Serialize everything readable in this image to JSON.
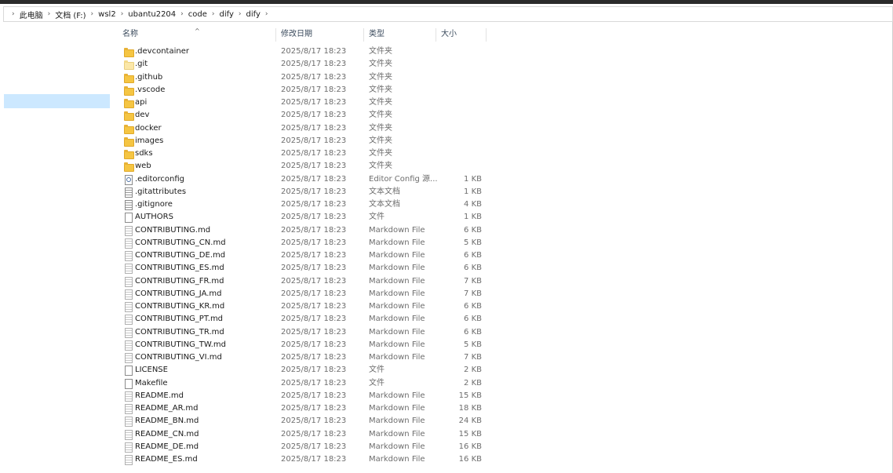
{
  "breadcrumb": [
    "此电脑",
    "文档 (F:)",
    "wsl2",
    "ubantu2204",
    "code",
    "dify",
    "dify"
  ],
  "columns": {
    "name": "名称",
    "date": "修改日期",
    "type": "类型",
    "size": "大小"
  },
  "files": [
    {
      "name": ".devcontainer",
      "date": "2025/8/17 18:23",
      "type": "文件夹",
      "size": "",
      "icon": "folder-icon"
    },
    {
      "name": ".git",
      "date": "2025/8/17 18:23",
      "type": "文件夹",
      "size": "",
      "icon": "folder-light-icon"
    },
    {
      "name": ".github",
      "date": "2025/8/17 18:23",
      "type": "文件夹",
      "size": "",
      "icon": "folder-icon"
    },
    {
      "name": ".vscode",
      "date": "2025/8/17 18:23",
      "type": "文件夹",
      "size": "",
      "icon": "folder-icon"
    },
    {
      "name": "api",
      "date": "2025/8/17 18:23",
      "type": "文件夹",
      "size": "",
      "icon": "folder-icon"
    },
    {
      "name": "dev",
      "date": "2025/8/17 18:23",
      "type": "文件夹",
      "size": "",
      "icon": "folder-icon"
    },
    {
      "name": "docker",
      "date": "2025/8/17 18:23",
      "type": "文件夹",
      "size": "",
      "icon": "folder-icon"
    },
    {
      "name": "images",
      "date": "2025/8/17 18:23",
      "type": "文件夹",
      "size": "",
      "icon": "folder-icon"
    },
    {
      "name": "sdks",
      "date": "2025/8/17 18:23",
      "type": "文件夹",
      "size": "",
      "icon": "folder-icon"
    },
    {
      "name": "web",
      "date": "2025/8/17 18:23",
      "type": "文件夹",
      "size": "",
      "icon": "folder-icon"
    },
    {
      "name": ".editorconfig",
      "date": "2025/8/17 18:23",
      "type": "Editor Config 源...",
      "size": "1 KB",
      "icon": "config-file-icon"
    },
    {
      "name": ".gitattributes",
      "date": "2025/8/17 18:23",
      "type": "文本文档",
      "size": "1 KB",
      "icon": "text-file-icon"
    },
    {
      "name": ".gitignore",
      "date": "2025/8/17 18:23",
      "type": "文本文档",
      "size": "4 KB",
      "icon": "text-file-icon"
    },
    {
      "name": "AUTHORS",
      "date": "2025/8/17 18:23",
      "type": "文件",
      "size": "1 KB",
      "icon": "file-icon"
    },
    {
      "name": "CONTRIBUTING.md",
      "date": "2025/8/17 18:23",
      "type": "Markdown File",
      "size": "6 KB",
      "icon": "markdown-file-icon"
    },
    {
      "name": "CONTRIBUTING_CN.md",
      "date": "2025/8/17 18:23",
      "type": "Markdown File",
      "size": "5 KB",
      "icon": "markdown-file-icon"
    },
    {
      "name": "CONTRIBUTING_DE.md",
      "date": "2025/8/17 18:23",
      "type": "Markdown File",
      "size": "6 KB",
      "icon": "markdown-file-icon"
    },
    {
      "name": "CONTRIBUTING_ES.md",
      "date": "2025/8/17 18:23",
      "type": "Markdown File",
      "size": "6 KB",
      "icon": "markdown-file-icon"
    },
    {
      "name": "CONTRIBUTING_FR.md",
      "date": "2025/8/17 18:23",
      "type": "Markdown File",
      "size": "7 KB",
      "icon": "markdown-file-icon"
    },
    {
      "name": "CONTRIBUTING_JA.md",
      "date": "2025/8/17 18:23",
      "type": "Markdown File",
      "size": "7 KB",
      "icon": "markdown-file-icon"
    },
    {
      "name": "CONTRIBUTING_KR.md",
      "date": "2025/8/17 18:23",
      "type": "Markdown File",
      "size": "6 KB",
      "icon": "markdown-file-icon"
    },
    {
      "name": "CONTRIBUTING_PT.md",
      "date": "2025/8/17 18:23",
      "type": "Markdown File",
      "size": "6 KB",
      "icon": "markdown-file-icon"
    },
    {
      "name": "CONTRIBUTING_TR.md",
      "date": "2025/8/17 18:23",
      "type": "Markdown File",
      "size": "6 KB",
      "icon": "markdown-file-icon"
    },
    {
      "name": "CONTRIBUTING_TW.md",
      "date": "2025/8/17 18:23",
      "type": "Markdown File",
      "size": "5 KB",
      "icon": "markdown-file-icon"
    },
    {
      "name": "CONTRIBUTING_VI.md",
      "date": "2025/8/17 18:23",
      "type": "Markdown File",
      "size": "7 KB",
      "icon": "markdown-file-icon"
    },
    {
      "name": "LICENSE",
      "date": "2025/8/17 18:23",
      "type": "文件",
      "size": "2 KB",
      "icon": "file-icon"
    },
    {
      "name": "Makefile",
      "date": "2025/8/17 18:23",
      "type": "文件",
      "size": "2 KB",
      "icon": "file-icon"
    },
    {
      "name": "README.md",
      "date": "2025/8/17 18:23",
      "type": "Markdown File",
      "size": "15 KB",
      "icon": "markdown-file-icon"
    },
    {
      "name": "README_AR.md",
      "date": "2025/8/17 18:23",
      "type": "Markdown File",
      "size": "18 KB",
      "icon": "markdown-file-icon"
    },
    {
      "name": "README_BN.md",
      "date": "2025/8/17 18:23",
      "type": "Markdown File",
      "size": "24 KB",
      "icon": "markdown-file-icon"
    },
    {
      "name": "README_CN.md",
      "date": "2025/8/17 18:23",
      "type": "Markdown File",
      "size": "15 KB",
      "icon": "markdown-file-icon"
    },
    {
      "name": "README_DE.md",
      "date": "2025/8/17 18:23",
      "type": "Markdown File",
      "size": "16 KB",
      "icon": "markdown-file-icon"
    },
    {
      "name": "README_ES.md",
      "date": "2025/8/17 18:23",
      "type": "Markdown File",
      "size": "16 KB",
      "icon": "markdown-file-icon"
    }
  ]
}
